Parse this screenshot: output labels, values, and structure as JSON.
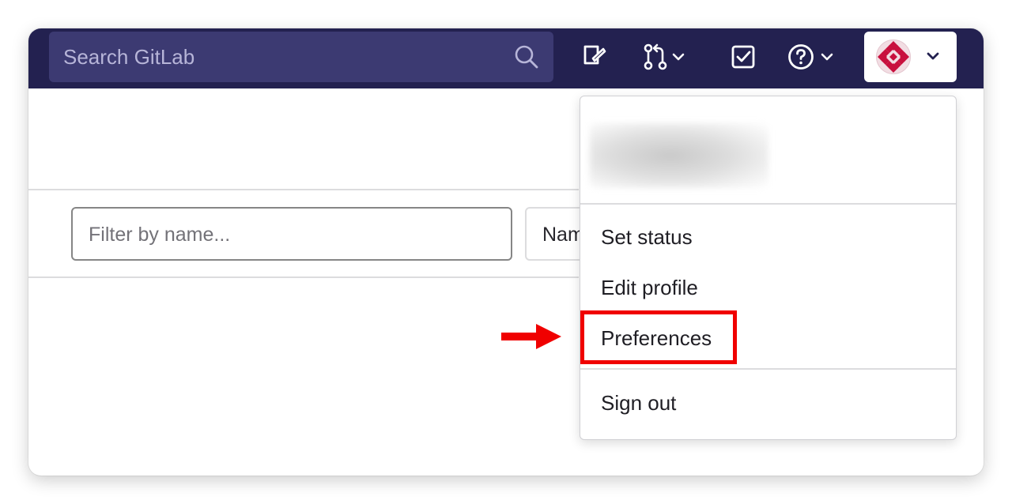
{
  "header": {
    "search": {
      "placeholder": "Search GitLab",
      "icon": "search-icon"
    },
    "icons": [
      "issues-icon",
      "merge-request-icon",
      "todo-icon",
      "help-icon"
    ],
    "avatar_icon": "avatar"
  },
  "filter": {
    "placeholder": "Filter by name..."
  },
  "sort": {
    "label": "Name"
  },
  "user_menu": {
    "items": [
      {
        "label": "Set status"
      },
      {
        "label": "Edit profile"
      },
      {
        "label": "Preferences"
      },
      {
        "label": "Sign out"
      }
    ],
    "highlighted_item": "Preferences"
  },
  "colors": {
    "topbar": "#232150",
    "search_bg": "#3c3a72",
    "highlight": "#f00000",
    "avatar_accent": "#c8103e"
  }
}
